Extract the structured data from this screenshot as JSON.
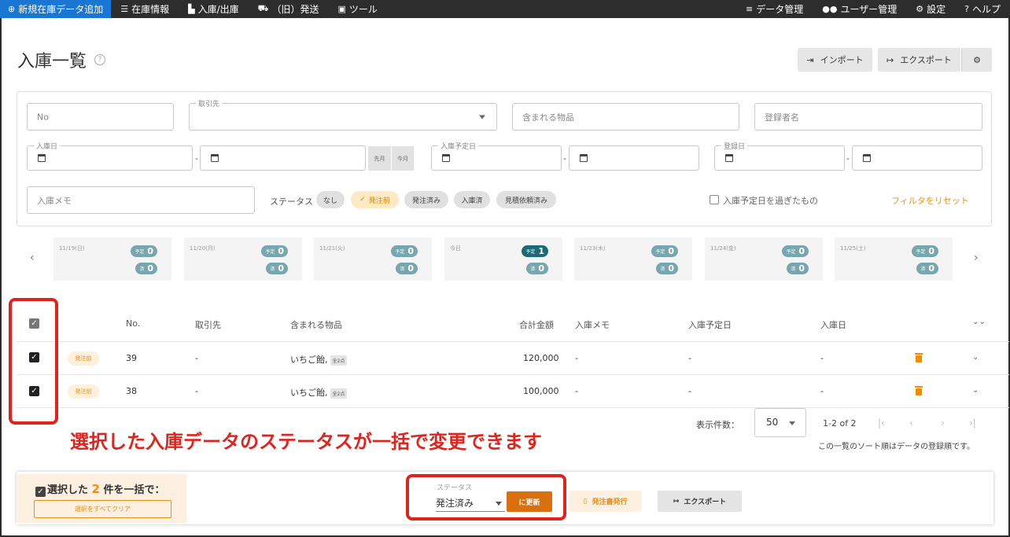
{
  "nav": {
    "left": [
      {
        "label": "新規在庫データ追加",
        "icon": "plus-circle-icon"
      },
      {
        "label": "在庫情報",
        "icon": "list-icon"
      },
      {
        "label": "入庫/出庫",
        "icon": "dolly-icon"
      },
      {
        "label": "（旧）発送",
        "icon": "truck-icon"
      },
      {
        "label": "ツール",
        "icon": "toolbox-icon"
      }
    ],
    "right": [
      {
        "label": "データ管理",
        "icon": "data-list-icon"
      },
      {
        "label": "ユーザー管理",
        "icon": "users-icon"
      },
      {
        "label": "設定",
        "icon": "gear-icon"
      },
      {
        "label": "ヘルプ",
        "icon": "question-circle-icon"
      }
    ]
  },
  "page": {
    "title": "入庫一覧",
    "import_label": "インポート",
    "export_label": "エクスポート"
  },
  "filters": {
    "no_placeholder": "No",
    "partner_label": "取引先",
    "items_placeholder": "含まれる物品",
    "registrant_placeholder": "登録者名",
    "receipt_date_label": "入庫日",
    "planned_date_label": "入庫予定日",
    "registered_date_label": "登録日",
    "last_month": "先月",
    "this_month": "今月",
    "memo_placeholder": "入庫メモ",
    "status_label": "ステータス",
    "status_chips": [
      "なし",
      "発注前",
      "発注済み",
      "入庫済",
      "見積依頼済み"
    ],
    "active_chip": "発注前",
    "past_due_label": "入庫予定日を過ぎたもの",
    "reset_label": "フィルタをリセット"
  },
  "calendar": {
    "days": [
      {
        "label": "11/19(日)",
        "planned": 0,
        "done": 0
      },
      {
        "label": "11/20(月)",
        "planned": 0,
        "done": 0
      },
      {
        "label": "11/21(火)",
        "planned": 0,
        "done": 0
      },
      {
        "label": "今日",
        "planned": 1,
        "done": 0
      },
      {
        "label": "11/23(木)",
        "planned": 0,
        "done": 0
      },
      {
        "label": "11/24(金)",
        "planned": 0,
        "done": 0
      },
      {
        "label": "11/25(土)",
        "planned": 0,
        "done": 0
      }
    ],
    "planned_tag": "予定",
    "done_tag": "済"
  },
  "table": {
    "headers": {
      "no": "No.",
      "partner": "取引先",
      "items": "含まれる物品",
      "total": "合計金額",
      "memo": "入庫メモ",
      "planned": "入庫予定日",
      "received": "入庫日"
    },
    "rows": [
      {
        "status": "発注前",
        "no": "39",
        "partner": "-",
        "items": "いちご飴,",
        "qty": "全2点",
        "total": "120,000",
        "memo": "-",
        "planned": "-",
        "received": "-"
      },
      {
        "status": "発注前",
        "no": "38",
        "partner": "-",
        "items": "いちご飴,",
        "qty": "全2点",
        "total": "100,000",
        "memo": "-",
        "planned": "-",
        "received": "-"
      }
    ]
  },
  "annotation": "選択した入庫データのステータスが一括で変更できます",
  "pager": {
    "per_page_label": "表示件数：",
    "per_page": "50",
    "range": "1-2 of 2",
    "sort_note": "この一覧のソート順はデータの登録順です。"
  },
  "bulk": {
    "prefix": "選択した",
    "count": "2",
    "suffix": "件を一括で：",
    "clear_label": "選択をすべてクリア",
    "status_label": "ステータス",
    "status_value": "発注済み",
    "update_label": "に更新",
    "issue_label": "発注書発行",
    "export_label": "エクスポート"
  },
  "colors": {
    "accent": "#1976d2",
    "orange": "#e6901a",
    "annotation_red": "#e0231d",
    "teal_dark": "#1a6b74",
    "teal": "#78a6ae"
  }
}
